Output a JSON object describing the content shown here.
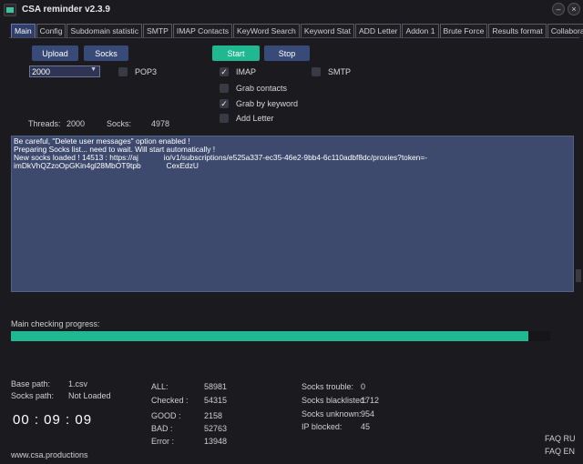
{
  "window": {
    "title": "CSA reminder v2.3.9"
  },
  "tabs": [
    {
      "label": "Main"
    },
    {
      "label": "Config"
    },
    {
      "label": "Subdomain statistic"
    },
    {
      "label": "SMTP"
    },
    {
      "label": "IMAP Contacts"
    },
    {
      "label": "KeyWord Search"
    },
    {
      "label": "Keyword Stat"
    },
    {
      "label": "ADD Letter"
    },
    {
      "label": "Addon 1"
    },
    {
      "label": "Brute Force"
    },
    {
      "label": "Results format"
    },
    {
      "label": "Collaboration"
    }
  ],
  "controls": {
    "upload_label": "Upload",
    "socks_label": "Socks",
    "start_label": "Start",
    "stop_label": "Stop",
    "threads_value": "2000"
  },
  "options": {
    "pop3": {
      "label": "POP3",
      "checked": false
    },
    "imap": {
      "label": "IMAP",
      "checked": true
    },
    "smtp": {
      "label": "SMTP",
      "checked": false
    },
    "grab_contacts": {
      "label": "Grab contacts",
      "checked": false
    },
    "grab_by_keyword": {
      "label": "Grab by keyword",
      "checked": true
    },
    "add_letter": {
      "label": "Add Letter",
      "checked": false
    }
  },
  "counters": {
    "threads_label": "Threads:",
    "threads_value": "2000",
    "socks_label": "Socks:",
    "socks_value": "4978"
  },
  "log": {
    "lines": [
      "Be careful, \"Delete user messages\" option enabled !",
      "Preparing Socks list... need to wait. Will start automatically !",
      "New socks loaded ! 14513 : https://aj            io/v1/subscriptions/e525a337-ec35-46e2-9bb4-6c110adbf8dc/proxies?token=-",
      "imDkVhQZzoOpGKin4gl28MbOT9tpb            CexEdzU"
    ]
  },
  "progress": {
    "label": "Main checking progress:",
    "fraction": 0.96
  },
  "paths": {
    "base_label": "Base path:",
    "base_value": "1.csv",
    "socks_label": "Socks path:",
    "socks_value": "Not Loaded"
  },
  "timer": "00 : 09 : 09",
  "stats": {
    "all_label": "ALL:",
    "all_value": "58981",
    "checked_label": "Checked :",
    "checked_value": "54315",
    "good_label": "GOOD :",
    "good_value": "2158",
    "bad_label": "BAD :",
    "bad_value": "52763",
    "error_label": "Error :",
    "error_value": "13948"
  },
  "socks_stats": {
    "trouble_label": "Socks trouble:",
    "trouble_value": "0",
    "blacklisted_label": "Socks blacklisted:",
    "blacklisted_value": "1712",
    "unknown_label": "Socks unknown:",
    "unknown_value": "954",
    "ipblocked_label": "IP blocked:",
    "ipblocked_value": "45"
  },
  "footer": {
    "site": "www.csa.productions",
    "faq_ru": "FAQ RU",
    "faq_en": "FAQ EN"
  },
  "icons": {
    "app": "app-icon",
    "close": "close-icon",
    "check": "check-icon",
    "dropdown": "chevron-down-icon"
  },
  "colors": {
    "accent": "#1fb890",
    "button": "#384a78",
    "log_bg": "#3d4a6e",
    "background": "#1b1b1f"
  }
}
